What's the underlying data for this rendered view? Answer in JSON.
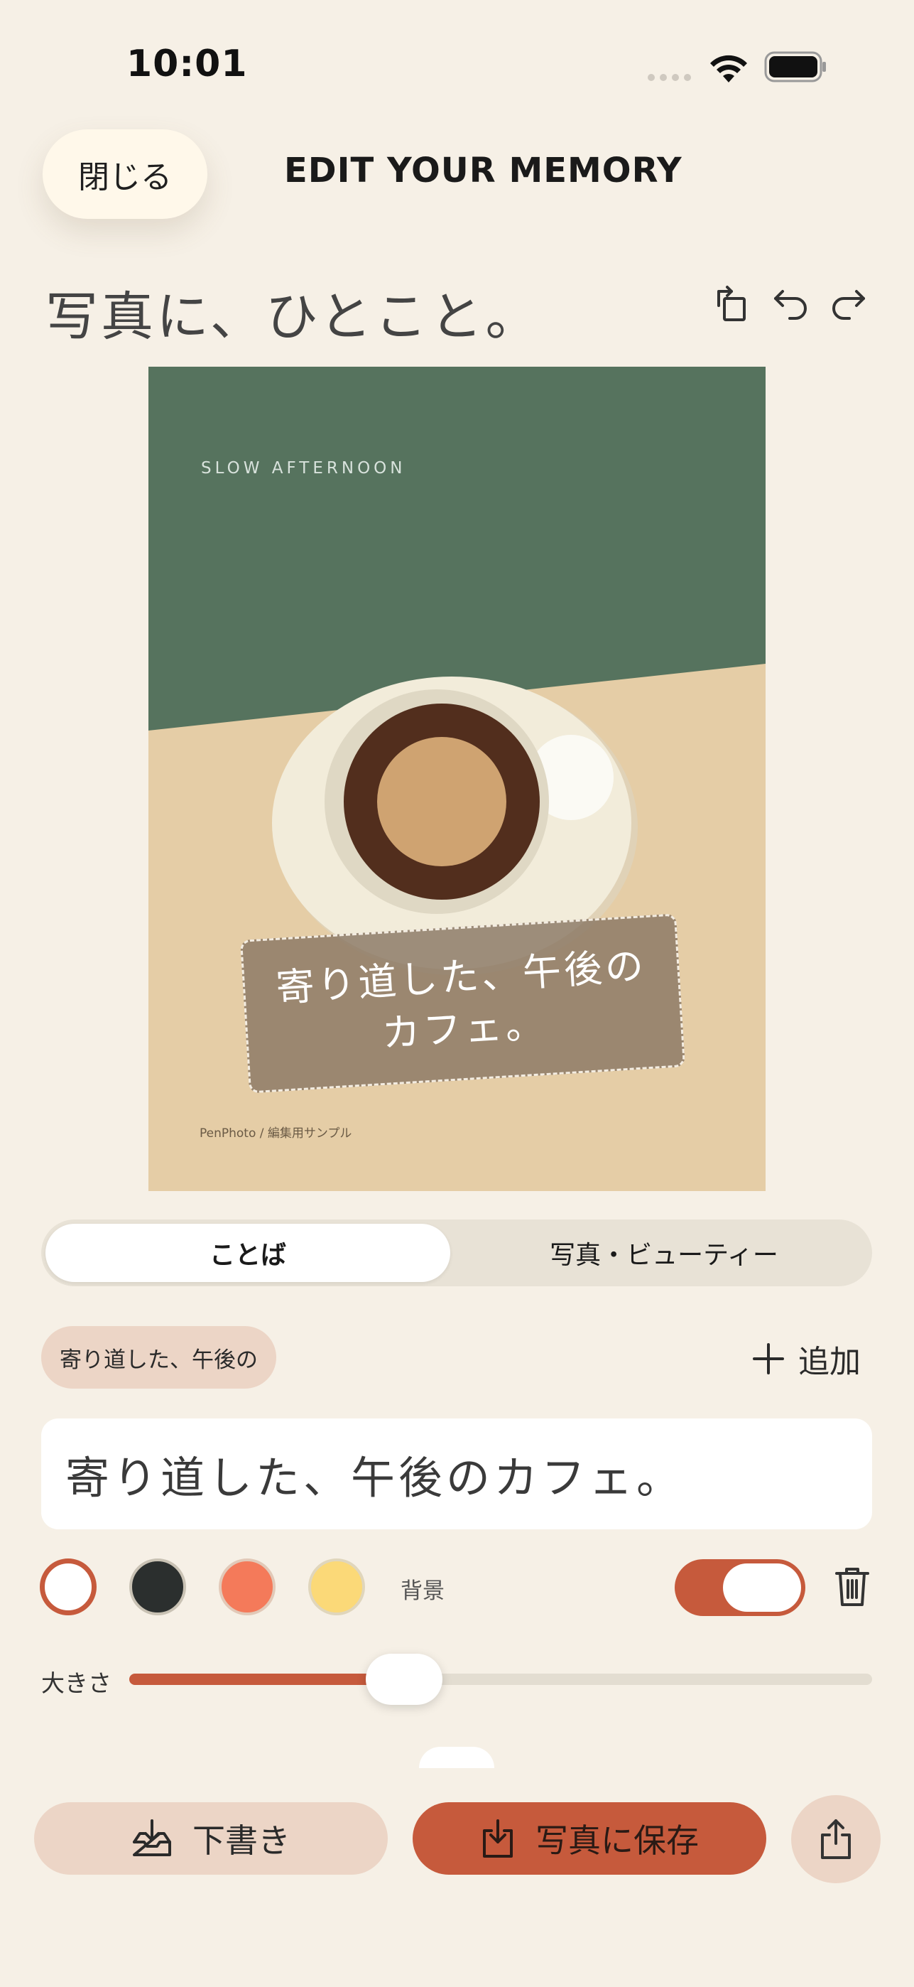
{
  "status_bar": {
    "time": "10:01",
    "icons": [
      "cellular-signal-icon",
      "wifi-icon",
      "battery-icon"
    ]
  },
  "header": {
    "close_label": "閉じる",
    "title": "EDIT YOUR MEMORY"
  },
  "page_title": "写真に、ひとこと。",
  "toolbar": {
    "icons": [
      "rotate-icon",
      "undo-icon",
      "redo-icon"
    ]
  },
  "photo": {
    "caption": "SLOW AFTERNOON",
    "credit": "PenPhoto / 編集用サンプル",
    "sticker_text": "寄り道した、午後のカフェ。"
  },
  "tabs": [
    {
      "label": "ことば",
      "active": true
    },
    {
      "label": "写真・ビューティー",
      "active": false
    }
  ],
  "text_editor": {
    "chip_label": "寄り道した、午後の",
    "add_label": "追加",
    "input_value": "寄り道した、午後のカフェ。",
    "colors": [
      "#ffffff",
      "#2b2f2e",
      "#f47a5a",
      "#fbd978"
    ],
    "selected_color": "#ffffff",
    "background_label": "背景",
    "background_enabled": true,
    "size_label": "大きさ",
    "size_value": 0.37
  },
  "actions": {
    "draft_label": "下書き",
    "save_label": "写真に保存",
    "share_icon": "share-icon"
  },
  "accent_color": "#c65a3c"
}
